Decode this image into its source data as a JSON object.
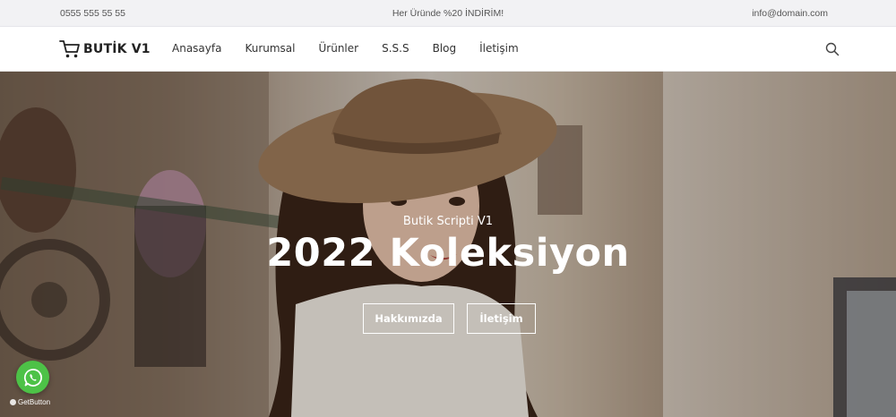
{
  "topbar": {
    "phone": "0555 555 55 55",
    "promo": "Her Üründe %20 İNDİRİM!",
    "email": "info@domain.com"
  },
  "header": {
    "logo_icon": "cart-icon",
    "logo_text": "BUTİK V1",
    "nav": [
      {
        "label": "Anasayfa"
      },
      {
        "label": "Kurumsal"
      },
      {
        "label": "Ürünler"
      },
      {
        "label": "S.S.S"
      },
      {
        "label": "Blog"
      },
      {
        "label": "İletişim"
      }
    ],
    "search_icon": "search-icon"
  },
  "hero": {
    "subtitle": "Butik Scripti V1",
    "title": "2022 Koleksiyon",
    "buttons": [
      {
        "label": "Hakkımızda"
      },
      {
        "label": "İletişim"
      }
    ],
    "image": "woman-in-straw-hat-photo"
  },
  "whatsapp": {
    "icon": "whatsapp-icon",
    "credit": "GetButton"
  },
  "colors": {
    "whatsapp_green": "#4dc247",
    "topbar_bg": "#f2f2f4",
    "text_dark": "#333333"
  }
}
